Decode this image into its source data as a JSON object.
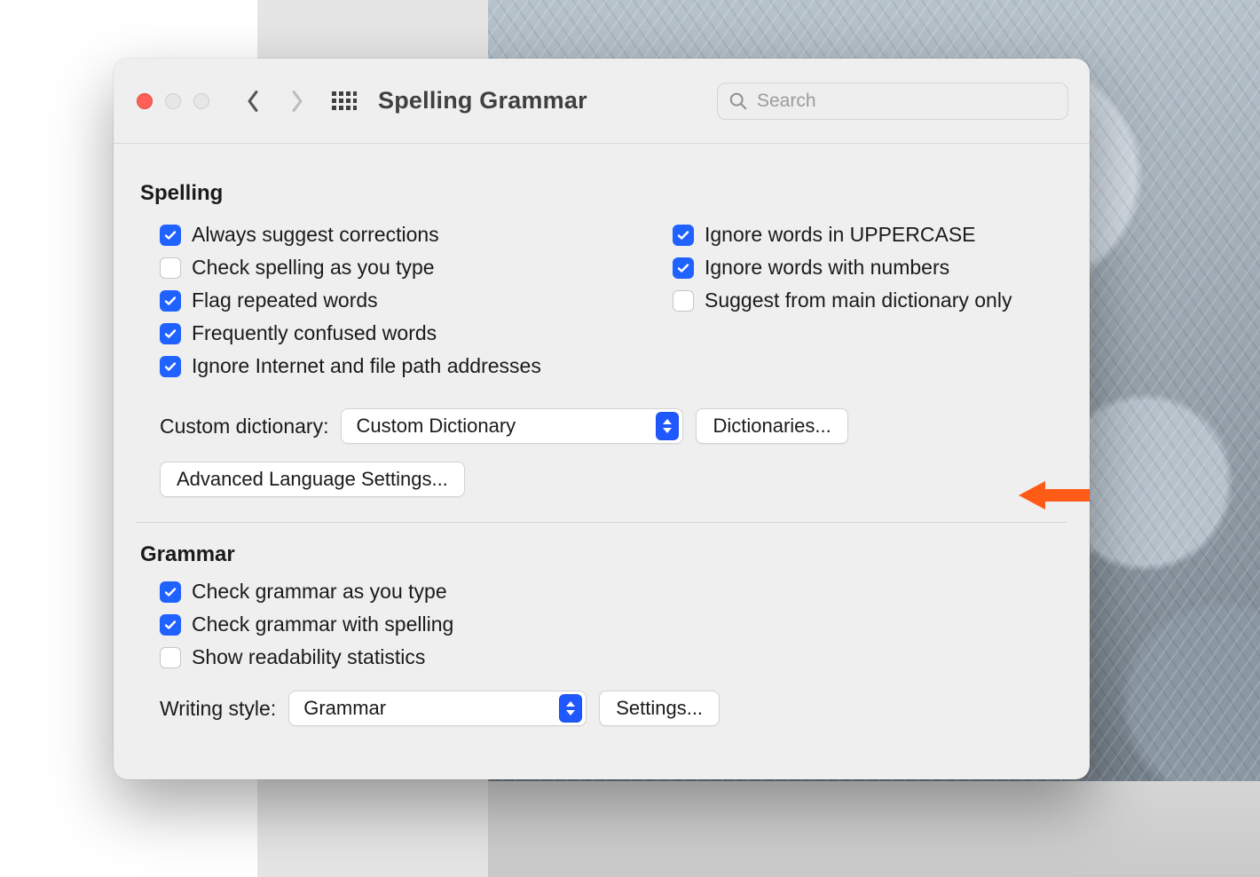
{
  "window": {
    "title": "Spelling  Grammar",
    "search_placeholder": "Search"
  },
  "spelling": {
    "heading": "Spelling",
    "left": [
      "Always suggest corrections",
      "Check spelling as you type",
      "Flag repeated words",
      "Frequently confused words",
      "Ignore Internet and file path addresses"
    ],
    "right": [
      "Ignore words in UPPERCASE",
      "Ignore words with numbers",
      "Suggest from main dictionary only"
    ],
    "custom_label": "Custom dictionary:",
    "custom_value": "Custom Dictionary",
    "dictionaries_button": "Dictionaries...",
    "advanced_button": "Advanced Language Settings..."
  },
  "grammar": {
    "heading": "Grammar",
    "items": [
      "Check grammar as you type",
      "Check grammar with spelling",
      "Show readability statistics"
    ],
    "writing_style_label": "Writing style:",
    "writing_style_value": "Grammar",
    "settings_button": "Settings..."
  }
}
